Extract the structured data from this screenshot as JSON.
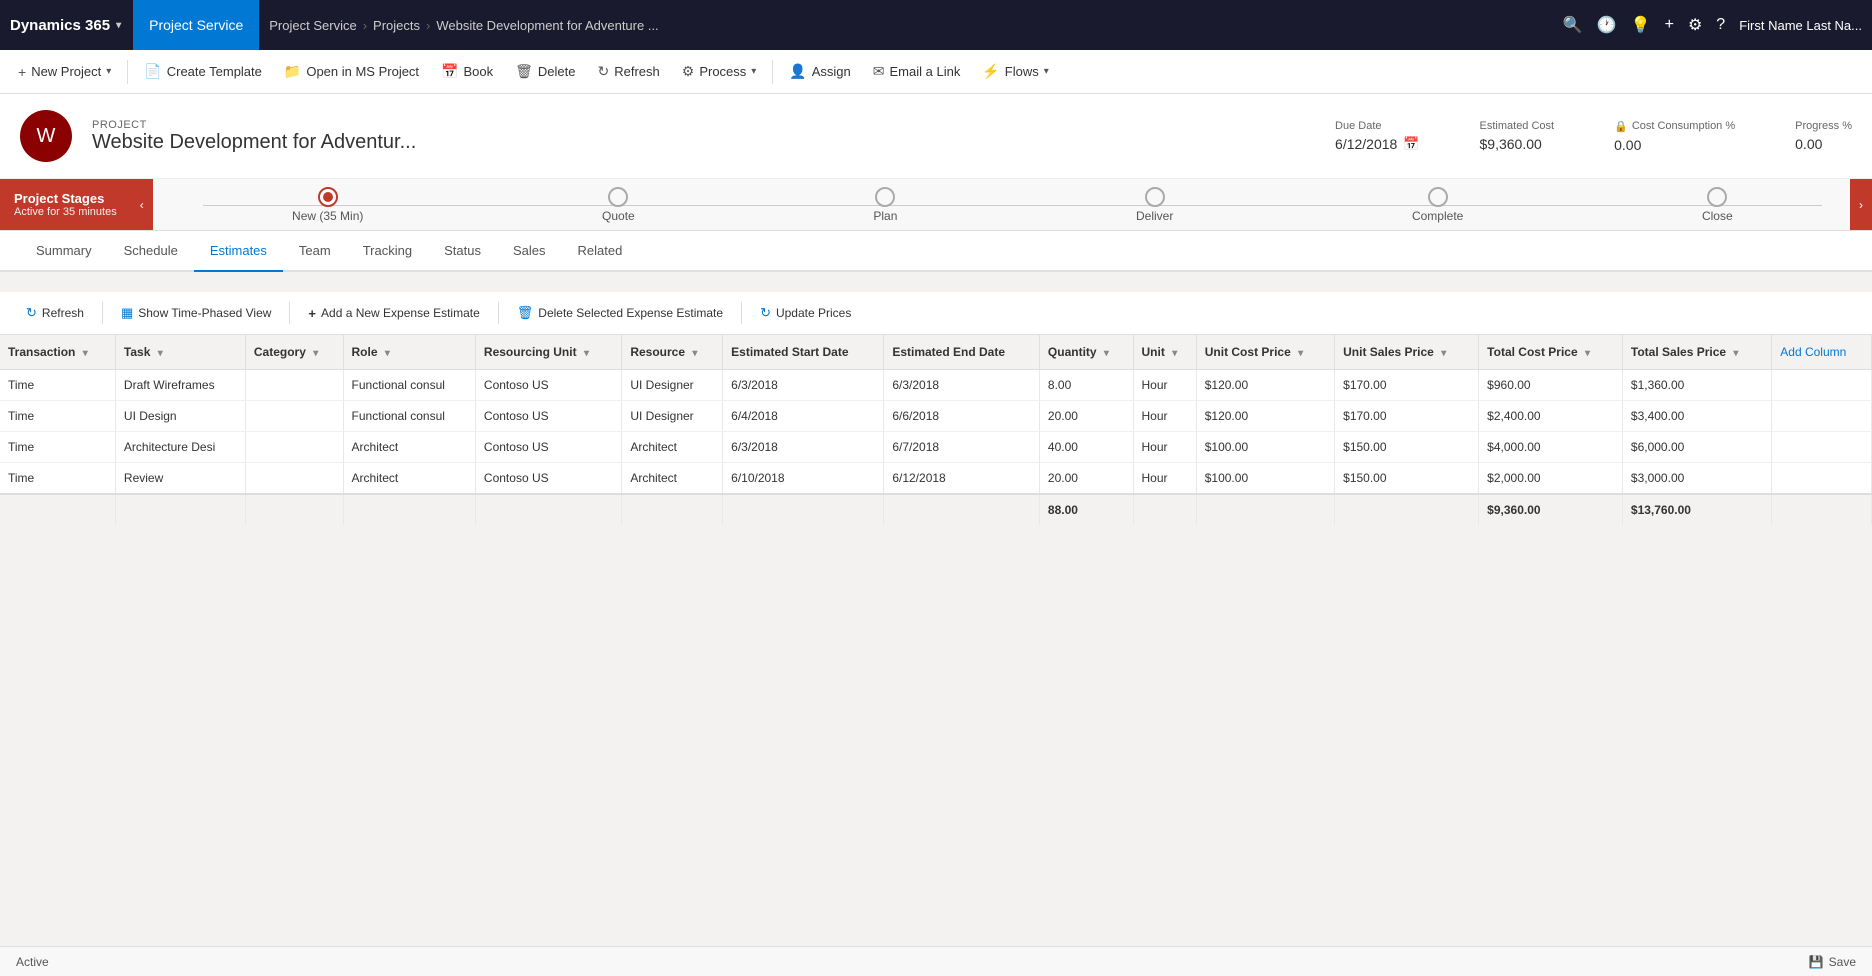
{
  "topNav": {
    "brand": "Dynamics 365",
    "brandChevron": "▾",
    "module": "Project Service",
    "breadcrumb": [
      "Project Service",
      "Projects",
      "Website Development for Adventure ..."
    ],
    "breadcrumbSeps": [
      ">",
      ">"
    ],
    "icons": [
      "🔍",
      "🕐",
      "💡",
      "+",
      "⚙",
      "?"
    ],
    "user": "First Name Last Na..."
  },
  "commandBar": {
    "buttons": [
      {
        "id": "new-project",
        "icon": "+",
        "label": "New Project",
        "hasChevron": true
      },
      {
        "id": "create-template",
        "icon": "📄",
        "label": "Create Template",
        "hasChevron": false
      },
      {
        "id": "open-ms-project",
        "icon": "📁",
        "label": "Open in MS Project",
        "hasChevron": false
      },
      {
        "id": "book",
        "icon": "📅",
        "label": "Book",
        "hasChevron": false
      },
      {
        "id": "delete",
        "icon": "🗑",
        "label": "Delete",
        "hasChevron": false
      },
      {
        "id": "refresh",
        "icon": "🔄",
        "label": "Refresh",
        "hasChevron": false
      },
      {
        "id": "process",
        "icon": "⚙",
        "label": "Process",
        "hasChevron": true
      },
      {
        "id": "assign",
        "icon": "👤",
        "label": "Assign",
        "hasChevron": false
      },
      {
        "id": "email-link",
        "icon": "✉",
        "label": "Email a Link",
        "hasChevron": false
      },
      {
        "id": "flows",
        "icon": "⚡",
        "label": "Flows",
        "hasChevron": true
      }
    ]
  },
  "projectHeader": {
    "label": "PROJECT",
    "name": "Website Development for Adventur...",
    "avatarLetter": "W",
    "meta": {
      "dueDate": {
        "label": "Due Date",
        "value": "6/12/2018"
      },
      "estimatedCost": {
        "label": "Estimated Cost",
        "value": "$9,360.00"
      },
      "costConsumption": {
        "label": "Cost Consumption %",
        "value": "0.00",
        "hasLock": true
      },
      "progress": {
        "label": "Progress %",
        "value": "0.00"
      }
    }
  },
  "stageBar": {
    "title": "Project Stages",
    "subtitle": "Active for 35 minutes",
    "stages": [
      {
        "id": "new",
        "label": "New (35 Min)",
        "active": true
      },
      {
        "id": "quote",
        "label": "Quote",
        "active": false
      },
      {
        "id": "plan",
        "label": "Plan",
        "active": false
      },
      {
        "id": "deliver",
        "label": "Deliver",
        "active": false
      },
      {
        "id": "complete",
        "label": "Complete",
        "active": false
      },
      {
        "id": "close",
        "label": "Close",
        "active": false
      }
    ]
  },
  "tabs": {
    "items": [
      "Summary",
      "Schedule",
      "Estimates",
      "Team",
      "Tracking",
      "Status",
      "Sales",
      "Related"
    ],
    "active": "Estimates"
  },
  "estimatesToolbar": {
    "buttons": [
      {
        "id": "refresh-est",
        "icon": "🔄",
        "label": "Refresh"
      },
      {
        "id": "show-time-phased",
        "icon": "📊",
        "label": "Show Time-Phased View"
      },
      {
        "id": "add-expense",
        "icon": "+",
        "label": "Add a New Expense Estimate"
      },
      {
        "id": "delete-expense",
        "icon": "🗑",
        "label": "Delete Selected Expense Estimate"
      },
      {
        "id": "update-prices",
        "icon": "🔄",
        "label": "Update Prices"
      }
    ]
  },
  "table": {
    "columns": [
      {
        "id": "transaction",
        "label": "Transaction",
        "sortable": true
      },
      {
        "id": "task",
        "label": "Task",
        "sortable": true
      },
      {
        "id": "category",
        "label": "Category",
        "sortable": true
      },
      {
        "id": "role",
        "label": "Role",
        "sortable": true
      },
      {
        "id": "resourcing-unit",
        "label": "Resourcing Unit",
        "sortable": true
      },
      {
        "id": "resource",
        "label": "Resource",
        "sortable": true
      },
      {
        "id": "est-start-date",
        "label": "Estimated Start Date",
        "sortable": false
      },
      {
        "id": "est-end-date",
        "label": "Estimated End Date",
        "sortable": false
      },
      {
        "id": "quantity",
        "label": "Quantity",
        "sortable": true
      },
      {
        "id": "unit",
        "label": "Unit",
        "sortable": true
      },
      {
        "id": "unit-cost-price",
        "label": "Unit Cost Price",
        "sortable": true
      },
      {
        "id": "unit-sales-price",
        "label": "Unit Sales Price",
        "sortable": true
      },
      {
        "id": "total-cost-price",
        "label": "Total Cost Price",
        "sortable": true
      },
      {
        "id": "total-sales-price",
        "label": "Total Sales Price",
        "sortable": true
      },
      {
        "id": "add-column",
        "label": "Add Column",
        "sortable": false
      }
    ],
    "rows": [
      {
        "transaction": "Time",
        "task": "Draft Wireframes",
        "category": "",
        "role": "Functional consul",
        "resourcingUnit": "Contoso US",
        "resource": "UI Designer",
        "estStartDate": "6/3/2018",
        "estEndDate": "6/3/2018",
        "quantity": "8.00",
        "unit": "Hour",
        "unitCostPrice": "$120.00",
        "unitSalesPrice": "$170.00",
        "totalCostPrice": "$960.00",
        "totalSalesPrice": "$1,360.00"
      },
      {
        "transaction": "Time",
        "task": "UI Design",
        "category": "",
        "role": "Functional consul",
        "resourcingUnit": "Contoso US",
        "resource": "UI Designer",
        "estStartDate": "6/4/2018",
        "estEndDate": "6/6/2018",
        "quantity": "20.00",
        "unit": "Hour",
        "unitCostPrice": "$120.00",
        "unitSalesPrice": "$170.00",
        "totalCostPrice": "$2,400.00",
        "totalSalesPrice": "$3,400.00"
      },
      {
        "transaction": "Time",
        "task": "Architecture Desi",
        "category": "",
        "role": "Architect",
        "resourcingUnit": "Contoso US",
        "resource": "Architect",
        "estStartDate": "6/3/2018",
        "estEndDate": "6/7/2018",
        "quantity": "40.00",
        "unit": "Hour",
        "unitCostPrice": "$100.00",
        "unitSalesPrice": "$150.00",
        "totalCostPrice": "$4,000.00",
        "totalSalesPrice": "$6,000.00"
      },
      {
        "transaction": "Time",
        "task": "Review",
        "category": "",
        "role": "Architect",
        "resourcingUnit": "Contoso US",
        "resource": "Architect",
        "estStartDate": "6/10/2018",
        "estEndDate": "6/12/2018",
        "quantity": "20.00",
        "unit": "Hour",
        "unitCostPrice": "$100.00",
        "unitSalesPrice": "$150.00",
        "totalCostPrice": "$2,000.00",
        "totalSalesPrice": "$3,000.00"
      }
    ],
    "footer": {
      "quantity": "88.00",
      "totalCostPrice": "$9,360.00",
      "totalSalesPrice": "$13,760.00"
    }
  },
  "statusBar": {
    "status": "Active",
    "saveLabel": "Save",
    "saveIcon": "💾"
  }
}
